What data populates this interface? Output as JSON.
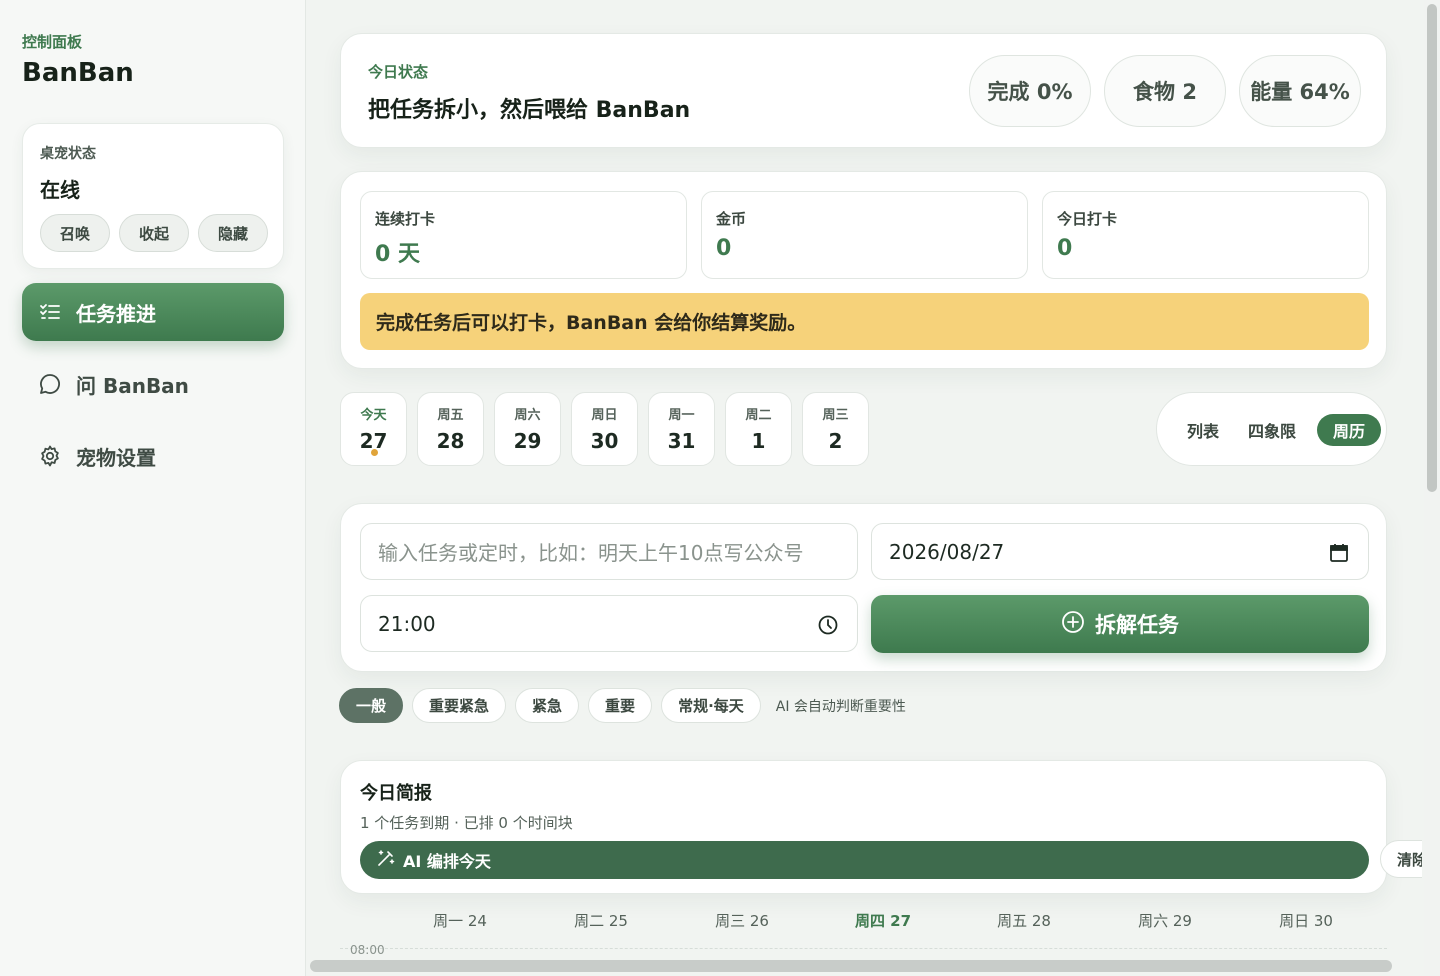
{
  "sidebar": {
    "subtitle": "控制面板",
    "title": "BanBan",
    "pet_card": {
      "label": "桌宠状态",
      "status": "在线",
      "buttons": [
        "召唤",
        "收起",
        "隐藏"
      ]
    },
    "nav": [
      {
        "label": "任务推进",
        "icon": "checklist-icon",
        "active": true
      },
      {
        "label": "问 BanBan",
        "icon": "chat-bubble-icon",
        "active": false
      },
      {
        "label": "宠物设置",
        "icon": "gear-icon",
        "active": false
      }
    ]
  },
  "status": {
    "label": "今日状态",
    "message": "把任务拆小，然后喂给 BanBan",
    "stats": [
      "完成 0%",
      "食物 2",
      "能量 64%"
    ]
  },
  "checkin": {
    "items": [
      {
        "label": "连续打卡",
        "value": "0 天"
      },
      {
        "label": "金币",
        "value": "0"
      },
      {
        "label": "今日打卡",
        "value": "0"
      }
    ],
    "notice": "完成任务后可以打卡，BanBan 会给你结算奖励。"
  },
  "days": [
    {
      "name": "今天",
      "date": "27",
      "today": true
    },
    {
      "name": "周五",
      "date": "28"
    },
    {
      "name": "周六",
      "date": "29"
    },
    {
      "name": "周日",
      "date": "30"
    },
    {
      "name": "周一",
      "date": "31"
    },
    {
      "name": "周二",
      "date": "1"
    },
    {
      "name": "周三",
      "date": "2"
    }
  ],
  "views": {
    "options": [
      "列表",
      "四象限",
      "周历"
    ],
    "selected": "周历"
  },
  "task_input": {
    "placeholder": "输入任务或定时，比如：明天上午10点写公众号",
    "date": "2026/08/27",
    "time": "21:00",
    "submit_label": "拆解任务"
  },
  "tags": {
    "options": [
      "一般",
      "重要紧急",
      "紧急",
      "重要",
      "常规·每天"
    ],
    "selected": "一般",
    "hint": "AI 会自动判断重要性"
  },
  "brief": {
    "title": "今日简报",
    "summary": "1 个任务到期 · 已排 0 个时间块",
    "ai_button": "AI 编排今天",
    "clear_button": "清除"
  },
  "week": {
    "days": [
      "周一 24",
      "周二 25",
      "周三 26",
      "周四 27",
      "周五 28",
      "周六 29",
      "周日 30"
    ],
    "today": "周四 27",
    "first_time": "08:00"
  },
  "colors": {
    "accent": "#3f7a4f",
    "notice": "#f6d27a",
    "ai_bar": "#3e6b4d"
  }
}
